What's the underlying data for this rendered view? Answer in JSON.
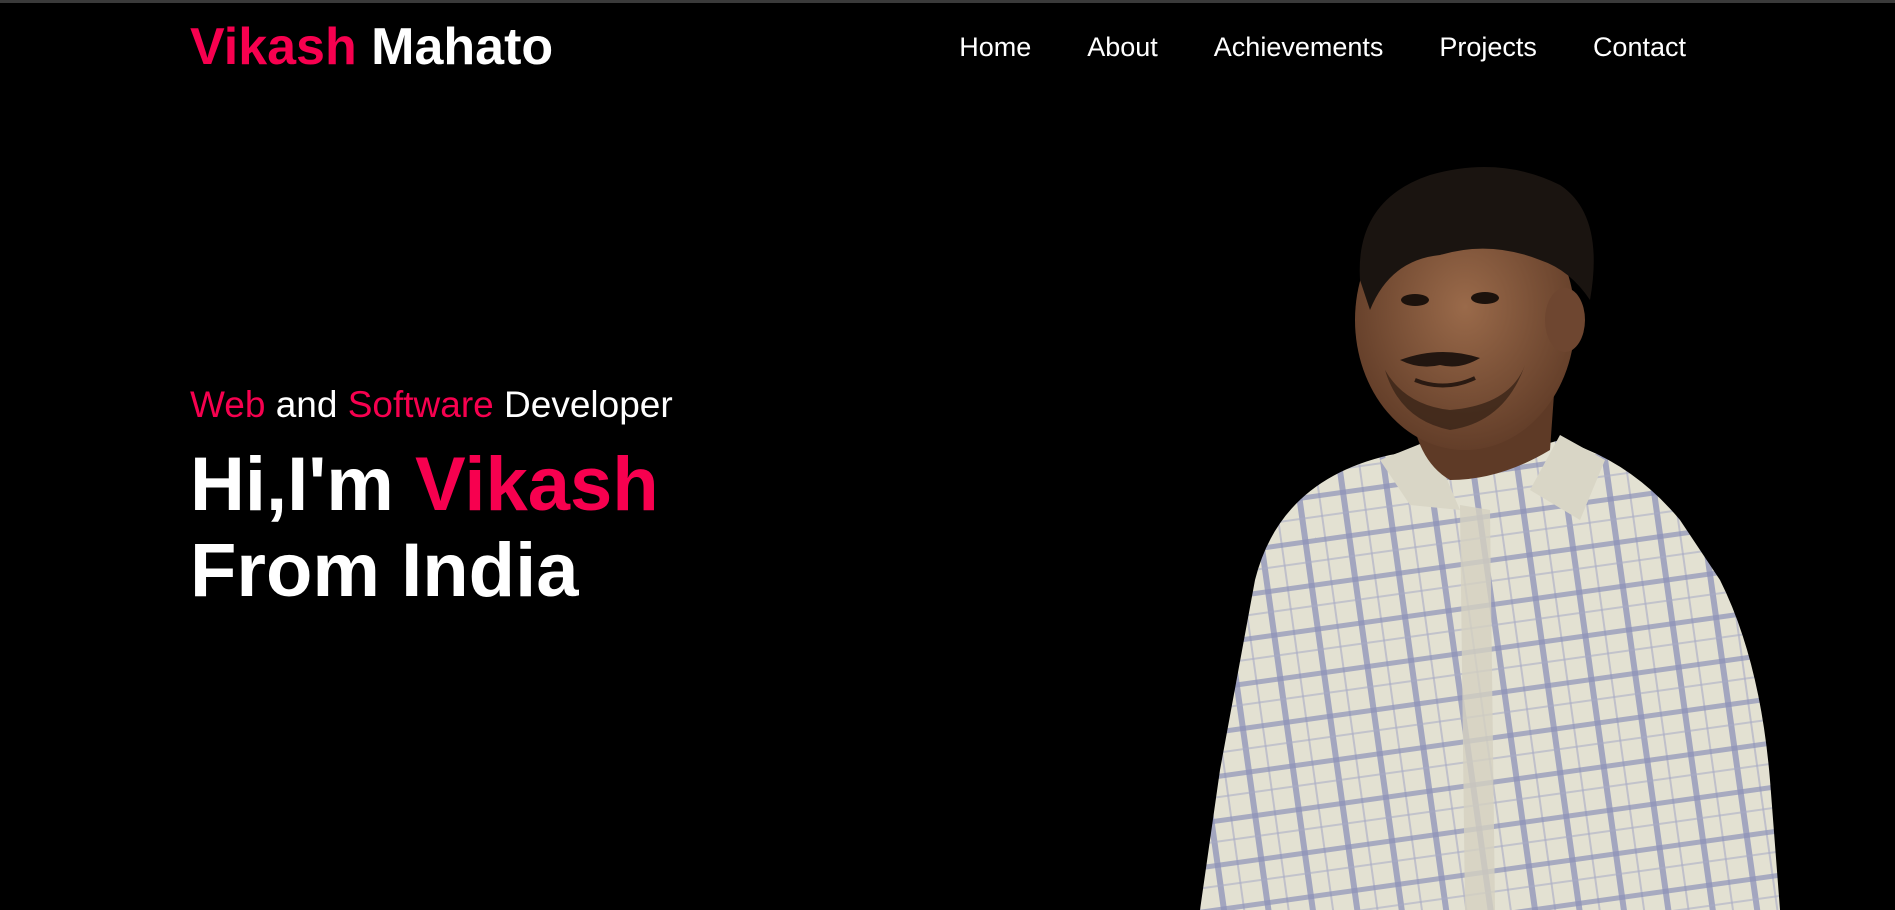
{
  "header": {
    "logo_first": "Vikash",
    "logo_last": "Mahato",
    "nav": [
      {
        "label": "Home"
      },
      {
        "label": "About"
      },
      {
        "label": "Achievements"
      },
      {
        "label": "Projects"
      },
      {
        "label": "Contact"
      }
    ]
  },
  "hero": {
    "subtitle": {
      "part1": "Web",
      "part2": "and",
      "part3": "Software",
      "part4": "Developer"
    },
    "headline": {
      "greeting": "Hi,I'm",
      "name": "Vikash",
      "line2": "From India"
    }
  },
  "colors": {
    "accent": "#f7004f",
    "background": "#000000",
    "text": "#ffffff"
  }
}
